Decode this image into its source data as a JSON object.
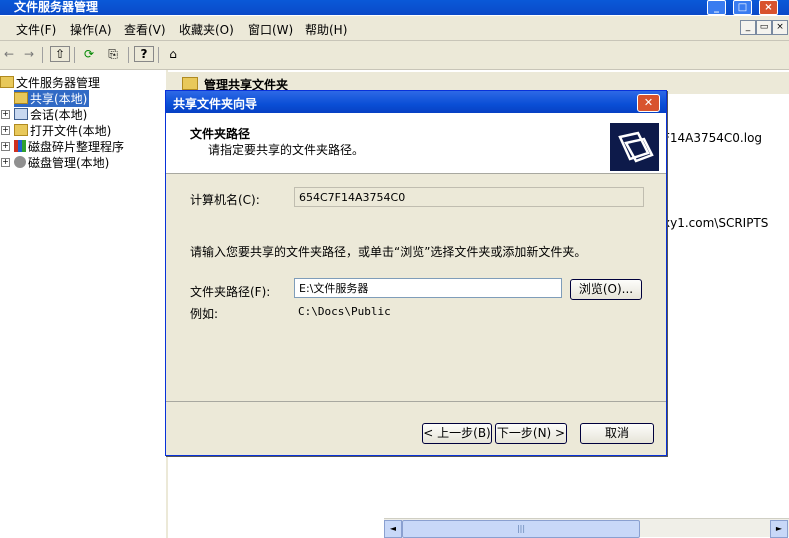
{
  "app": {
    "title": "文件服务器管理",
    "min_label": "_",
    "max_label": "□",
    "close_label": "×"
  },
  "menubar": {
    "items": [
      "文件(F)",
      "操作(A)",
      "查看(V)",
      "收藏夹(O)",
      "窗口(W)",
      "帮助(H)"
    ],
    "mdi_min": "_",
    "mdi_restore": "▭",
    "mdi_close": "×"
  },
  "toolbar": {
    "back": "←",
    "forward": "→",
    "up": "⇧",
    "refresh": "⟳",
    "export": "⎘",
    "help": "?",
    "share": "⌂"
  },
  "tree": {
    "root": "文件服务器管理",
    "items": [
      "共享(本地)",
      "会话(本地)",
      "打开文件(本地)",
      "磁盘碎片整理程序",
      "磁盘管理(本地)"
    ]
  },
  "rightpane": {
    "header": "管理共享文件夹",
    "frag1": "F14A3754C0.log",
    "frag2": "xy1.com\\SCRIPTS",
    "scroll_thumb": "|||",
    "scroll_left": "◄",
    "scroll_right": "►"
  },
  "dialog": {
    "title": "共享文件夹向导",
    "close": "✕",
    "heading": "文件夹路径",
    "subheading": "请指定要共享的文件夹路径。",
    "computer_label": "计算机名(C):",
    "computer_value": "654C7F14A3754C0",
    "instruction": "请输入您要共享的文件夹路径，或单击“浏览”选择文件夹或添加新文件夹。",
    "path_label": "文件夹路径(F):",
    "path_value": "E:\\文件服务器",
    "browse": "浏览(O)...",
    "example_label": "例如:",
    "example_value": "C:\\Docs\\Public",
    "back": "< 上一步(B)",
    "next": "下一步(N) >",
    "cancel": "取消"
  },
  "colors": {
    "titlebar": "#0a4fd6",
    "chrome": "#ece9d8",
    "close_red": "#d8532d"
  }
}
